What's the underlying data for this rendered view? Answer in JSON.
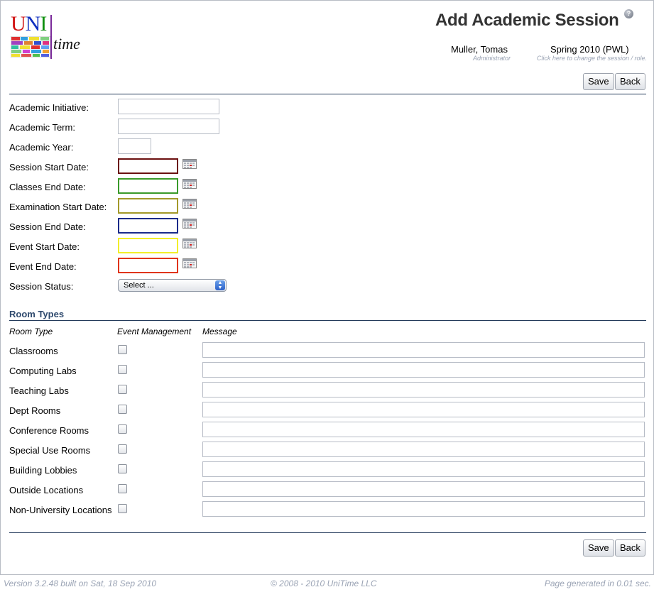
{
  "header": {
    "logo": {
      "uni_u": "U",
      "uni_n": "N",
      "uni_i": "I",
      "time": "time"
    },
    "title": "Add Academic Session",
    "help_icon": "help-icon",
    "user": {
      "name": "Muller, Tomas",
      "role": "Administrator"
    },
    "session": {
      "name": "Spring 2010 (PWL)",
      "hint": "Click here to change the session / role."
    }
  },
  "toolbar": {
    "save_label": "Save",
    "back_label": "Back"
  },
  "form": {
    "academic_initiative": {
      "label": "Academic Initiative:",
      "value": ""
    },
    "academic_term": {
      "label": "Academic Term:",
      "value": ""
    },
    "academic_year": {
      "label": "Academic Year:",
      "value": ""
    },
    "dates": [
      {
        "label": "Session Start Date:",
        "value": "",
        "color": "#6b1010"
      },
      {
        "label": "Classes End Date:",
        "value": "",
        "color": "#3a9a2a"
      },
      {
        "label": "Examination Start Date:",
        "value": "",
        "color": "#a3992a"
      },
      {
        "label": "Session End Date:",
        "value": "",
        "color": "#1a2a8a"
      },
      {
        "label": "Event Start Date:",
        "value": "",
        "color": "#f2ee2a"
      },
      {
        "label": "Event End Date:",
        "value": "",
        "color": "#e0341a"
      }
    ],
    "session_status": {
      "label": "Session Status:",
      "selected": "Select ..."
    }
  },
  "room_types": {
    "title": "Room Types",
    "columns": {
      "room_type": "Room Type",
      "event_management": "Event Management",
      "message": "Message"
    },
    "rows": [
      {
        "name": "Classrooms",
        "checked": false,
        "message": ""
      },
      {
        "name": "Computing Labs",
        "checked": false,
        "message": ""
      },
      {
        "name": "Teaching Labs",
        "checked": false,
        "message": ""
      },
      {
        "name": "Dept Rooms",
        "checked": false,
        "message": ""
      },
      {
        "name": "Conference Rooms",
        "checked": false,
        "message": ""
      },
      {
        "name": "Special Use Rooms",
        "checked": false,
        "message": ""
      },
      {
        "name": "Building Lobbies",
        "checked": false,
        "message": ""
      },
      {
        "name": "Outside Locations",
        "checked": false,
        "message": ""
      },
      {
        "name": "Non-University Locations",
        "checked": false,
        "message": ""
      }
    ]
  },
  "footer": {
    "version": "Version 3.2.48 built on Sat, 18 Sep 2010",
    "copyright": "© 2008 - 2010 UniTime LLC",
    "generated": "Page generated in 0.01 sec."
  }
}
